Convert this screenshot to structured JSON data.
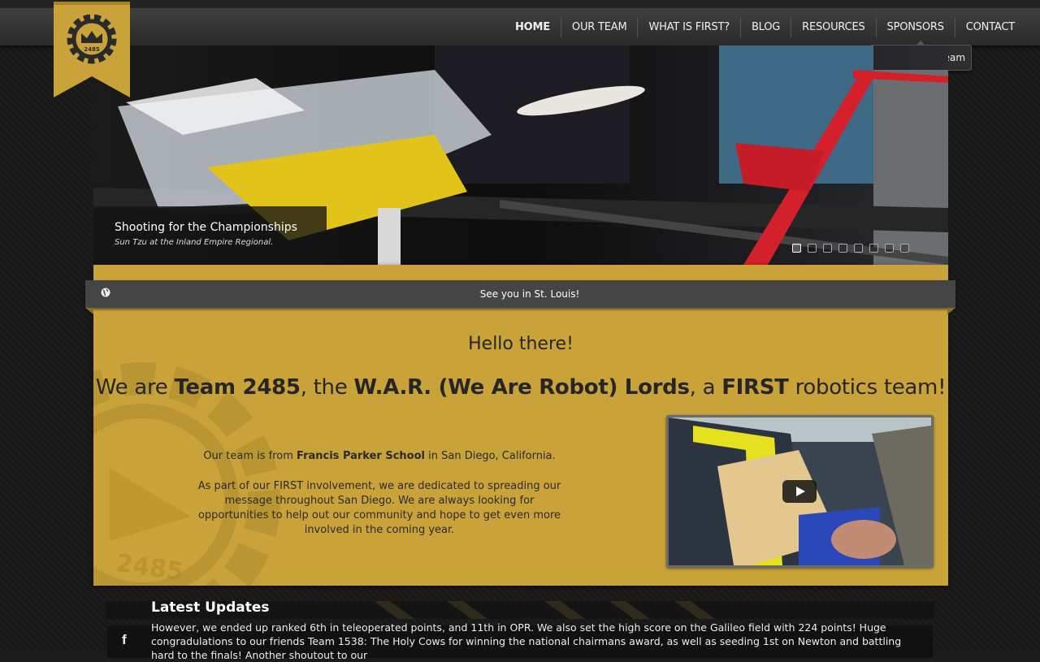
{
  "nav": {
    "items": [
      "HOME",
      "OUR TEAM",
      "WHAT IS FIRST?",
      "BLOG",
      "RESOURCES",
      "SPONSORS",
      "CONTACT"
    ],
    "active": "HOME",
    "tooltip": "Sponsor Our Team"
  },
  "logo": {
    "team_number": "2485"
  },
  "slider": {
    "caption_title": "Shooting for the Championships",
    "caption_subtitle": "Sun Tzu at the Inland Empire Regional.",
    "slide_count": 8,
    "active_slide": 1
  },
  "ticker": {
    "icon": "globe-icon",
    "text": "See you in St. Louis!"
  },
  "main": {
    "greeting": "Hello there!",
    "intro": {
      "p1": "We are ",
      "b1": "Team 2485",
      "p2": ", the ",
      "b2": "W.A.R. (We Are Robot) Lords",
      "p3": ", a ",
      "b3": "FIRST",
      "p4": " robotics team!"
    },
    "about1": {
      "pre": "Our team is from ",
      "bold": "Francis Parker School",
      "post": " in San Diego, California."
    },
    "about2": "As part of our FIRST involvement, we are dedicated to spreading our message throughout San Diego. We are always looking for opportunities to help out our community and hope to get even more involved in the coming year.",
    "watermark": "2485"
  },
  "updates": {
    "title": "Latest Updates",
    "social_icon": "facebook-icon",
    "social_glyph": "f",
    "text": "However, we ended up ranked 6th in teleoperated points, and 11th in OPR. We also set the high score on the Galileo field with 224 points! Huge congradulations to our friends Team 1538: The Holy Cows for winning the national chairmans award, as well as seeding 1st on Newton and battling hard to the finals! Another shoutout to our"
  },
  "colors": {
    "gold": "#c9a33a",
    "dark": "#1b1b1b",
    "nav": "#3a3a3a"
  }
}
